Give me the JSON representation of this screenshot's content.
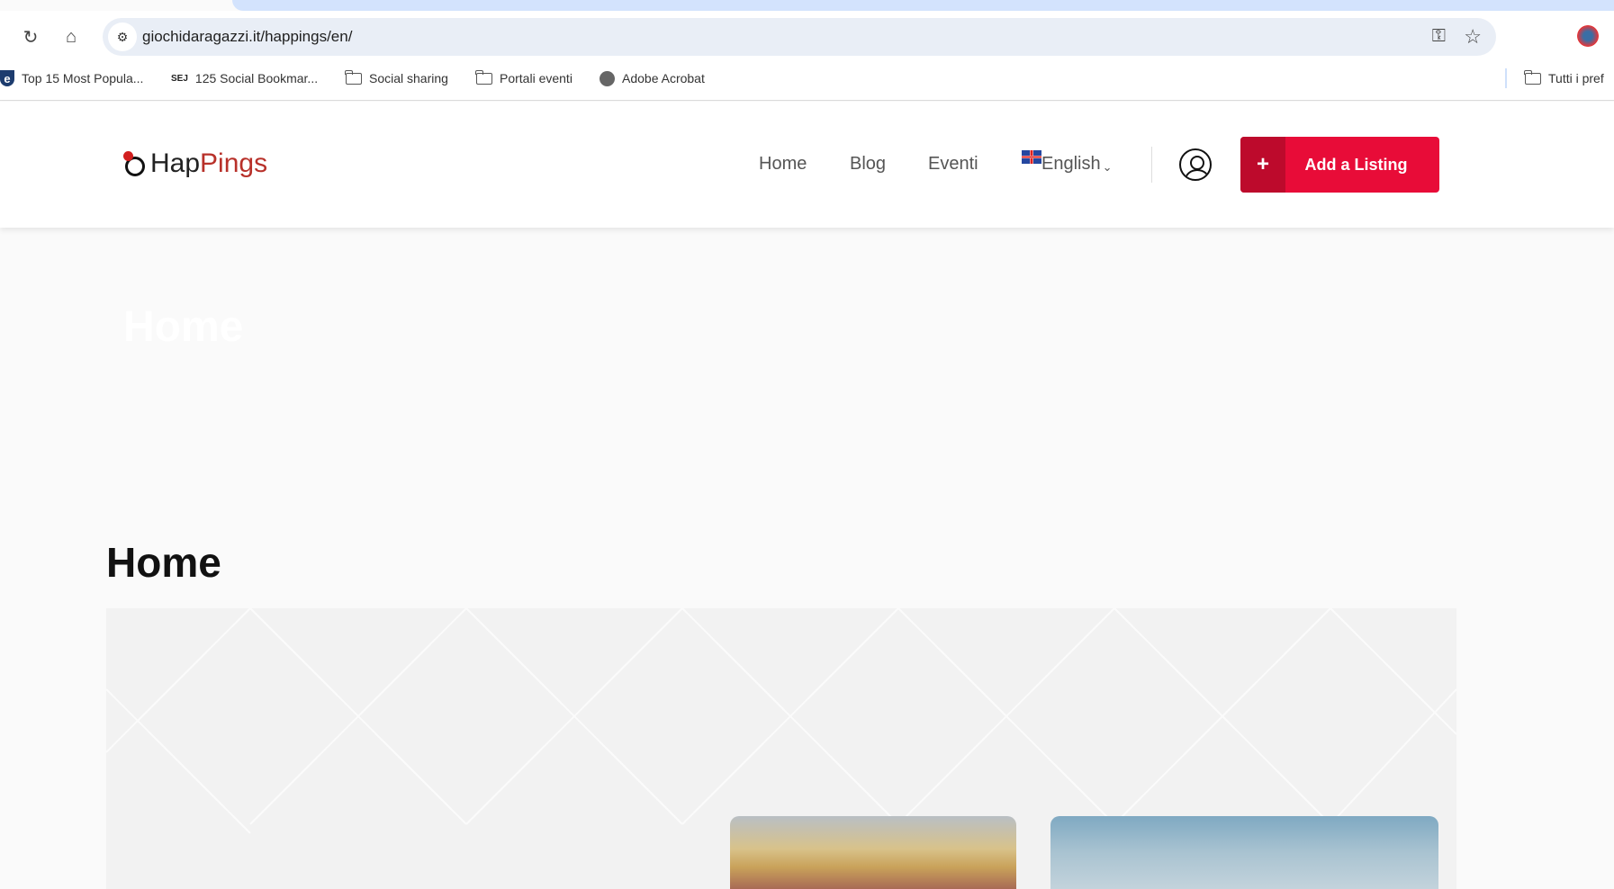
{
  "browser": {
    "url": "giochidaragazzi.it/happings/en/",
    "bookmarks": [
      {
        "label": "Top 15 Most Popula...",
        "icon": "e-icon"
      },
      {
        "label": "125 Social Bookmar...",
        "icon": "sej-icon"
      },
      {
        "label": "Social sharing",
        "icon": "folder-icon"
      },
      {
        "label": "Portali eventi",
        "icon": "folder-icon"
      },
      {
        "label": "Adobe Acrobat",
        "icon": "globe-icon"
      }
    ],
    "all_bookmarks": "Tutti i pref"
  },
  "header": {
    "logo": {
      "part1": "Hap",
      "part2": "Pings"
    },
    "nav": [
      "Home",
      "Blog",
      "Eventi"
    ],
    "language": "English",
    "add_listing": "Add a Listing",
    "accent": "#e80c38"
  },
  "main": {
    "faint_title": "Home",
    "title": "Home"
  }
}
